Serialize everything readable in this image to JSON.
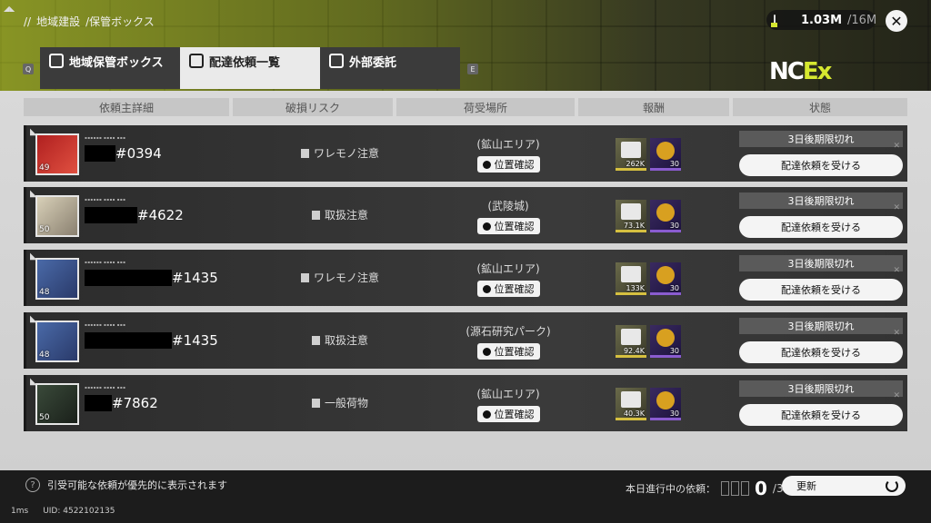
{
  "header": {
    "breadcrumb": [
      "地域建設",
      "/保管ボックス"
    ],
    "resource_value": "1.03M",
    "resource_cap": "/16M",
    "close_glyph": "✕"
  },
  "tabs": [
    {
      "label": "地域保管ボックス",
      "active": false
    },
    {
      "label": "配達依頼一覧",
      "active": true
    },
    {
      "label": "外部委託",
      "active": false
    }
  ],
  "keys": {
    "left": "Q",
    "right": "E"
  },
  "logo": {
    "main": "NC",
    "accent": "Ex"
  },
  "columns": [
    "依頼主詳細",
    "破損リスク",
    "荷受場所",
    "報酬",
    "状態"
  ],
  "rows": [
    {
      "level": "49",
      "id": "#0394",
      "risk": "ワレモノ注意",
      "place": "(鉱山エリア)",
      "loc_label": "位置確認",
      "money": "262K",
      "coin": "30",
      "deadline": "3日後期限切れ",
      "action": "配達依頼を受ける"
    },
    {
      "level": "50",
      "id": "#4622",
      "risk": "取扱注意",
      "place": "(武陵城)",
      "loc_label": "位置確認",
      "money": "73.1K",
      "coin": "30",
      "deadline": "3日後期限切れ",
      "action": "配達依頼を受ける"
    },
    {
      "level": "48",
      "id": "#1435",
      "risk": "ワレモノ注意",
      "place": "(鉱山エリア)",
      "loc_label": "位置確認",
      "money": "133K",
      "coin": "30",
      "deadline": "3日後期限切れ",
      "action": "配達依頼を受ける"
    },
    {
      "level": "48",
      "id": "#1435",
      "risk": "取扱注意",
      "place": "(源石研究パーク)",
      "loc_label": "位置確認",
      "money": "92.4K",
      "coin": "30",
      "deadline": "3日後期限切れ",
      "action": "配達依頼を受ける"
    },
    {
      "level": "50",
      "id": "#7862",
      "risk": "一般荷物",
      "place": "(鉱山エリア)",
      "loc_label": "位置確認",
      "money": "40.3K",
      "coin": "30",
      "deadline": "3日後期限切れ",
      "action": "配達依頼を受ける"
    }
  ],
  "footer": {
    "hint": "引受可能な依頼が優先的に表示されます",
    "today_label": "本日進行中の依頼：",
    "today_count": "0",
    "today_total": "/3",
    "refresh_label": "更新",
    "ping": "1ms",
    "uid": "UID: 4522102135"
  },
  "colors": {
    "accent": "#d6e830",
    "row_bg": "#333333",
    "button_bg": "#f4f4f4"
  }
}
